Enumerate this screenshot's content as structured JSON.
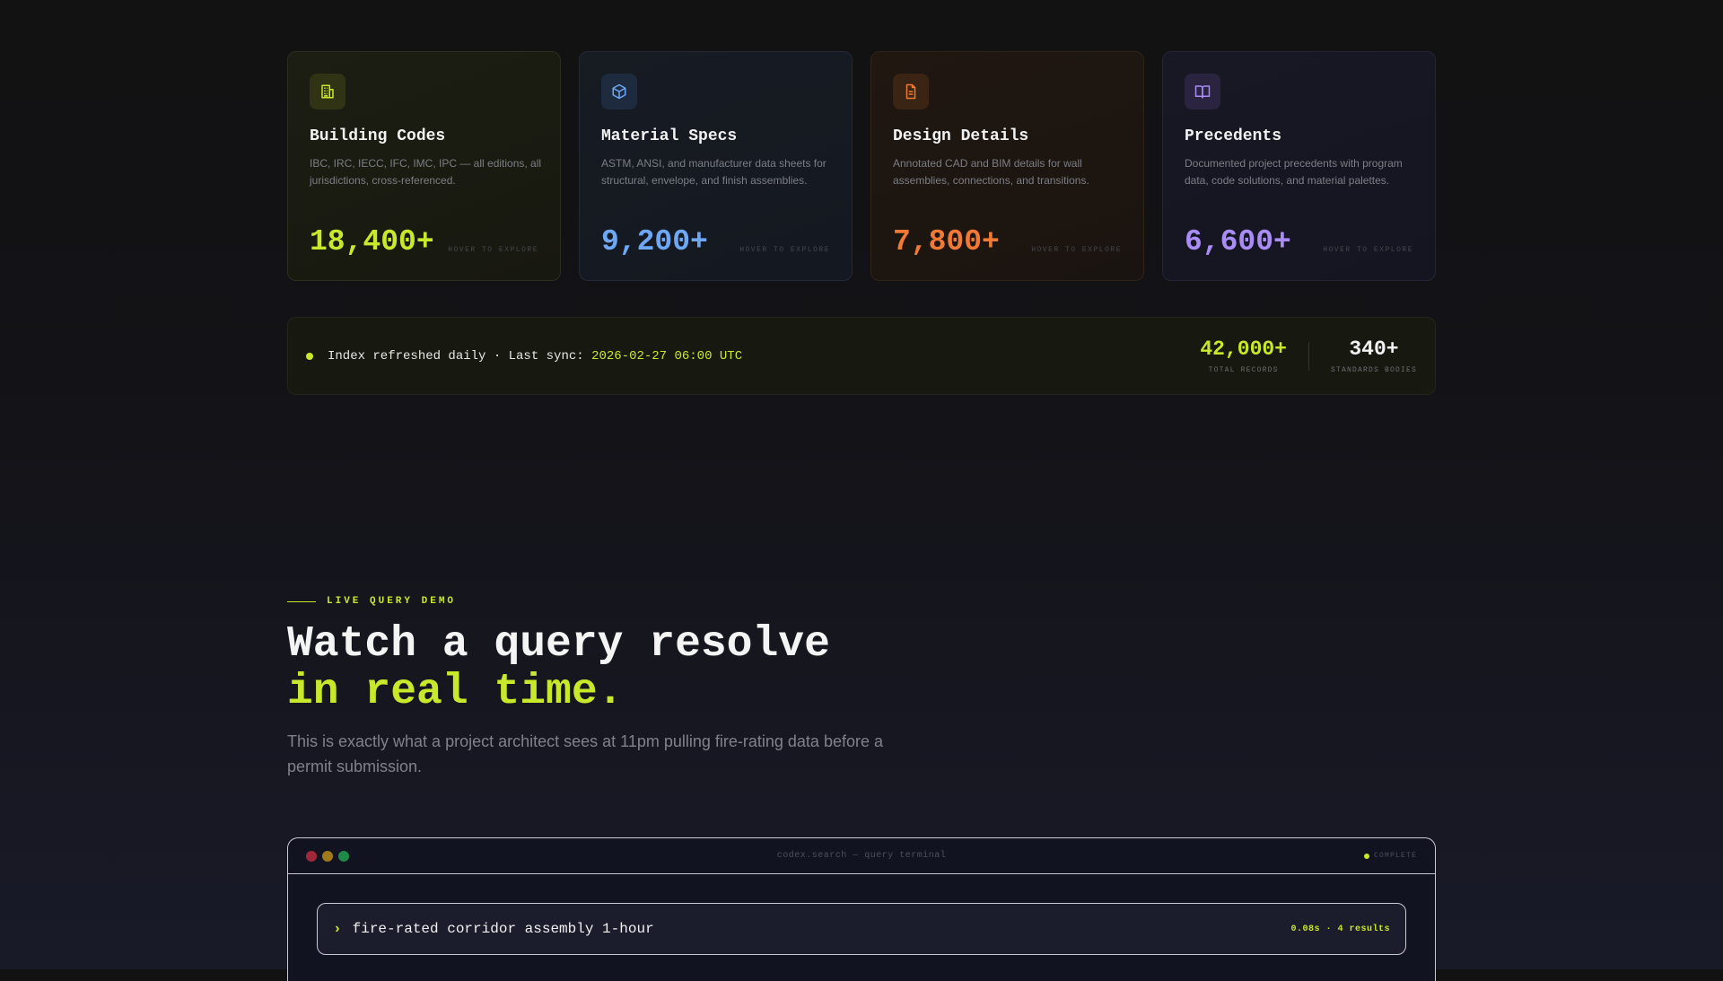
{
  "colors": {
    "accent_lime": "#c8e82b",
    "accent_blue": "#6ea8f5",
    "accent_orange": "#f07a35",
    "accent_purple": "#a98cf5"
  },
  "cards": [
    {
      "icon": "building-icon",
      "title": "Building Codes",
      "description": "IBC, IRC, IECC, IFC, IMC, IPC — all editions, all jurisdictions, cross-referenced.",
      "count": "18,400+",
      "hint": "HOVER TO EXPLORE"
    },
    {
      "icon": "cube-icon",
      "title": "Material Specs",
      "description": "ASTM, ANSI, and manufacturer data sheets for structural, envelope, and finish assemblies.",
      "count": "9,200+",
      "hint": "HOVER TO EXPLORE"
    },
    {
      "icon": "document-icon",
      "title": "Design Details",
      "description": "Annotated CAD and BIM details for wall assemblies, connections, and transitions.",
      "count": "7,800+",
      "hint": "HOVER TO EXPLORE"
    },
    {
      "icon": "book-icon",
      "title": "Precedents",
      "description": "Documented project precedents with program data, code solutions, and material palettes.",
      "count": "6,600+",
      "hint": "HOVER TO EXPLORE"
    }
  ],
  "sync": {
    "text": "Index refreshed daily · Last sync: ",
    "timestamp": "2026-02-27 06:00 UTC",
    "stats": [
      {
        "value": "42,000+",
        "label": "TOTAL RECORDS"
      },
      {
        "value": "340+",
        "label": "STANDARDS BODIES"
      }
    ]
  },
  "section": {
    "eyebrow": "LIVE QUERY DEMO",
    "headline_line1": "Watch a query resolve",
    "headline_line2": "in real time.",
    "lede": "This is exactly what a project architect sees at 11pm pulling fire-rating data before a permit submission."
  },
  "terminal": {
    "title": "codex.search — query terminal",
    "status": "COMPLETE",
    "prompt": "›",
    "query": "fire-rated corridor assembly 1-hour",
    "meta": "0.08s · 4 results"
  }
}
